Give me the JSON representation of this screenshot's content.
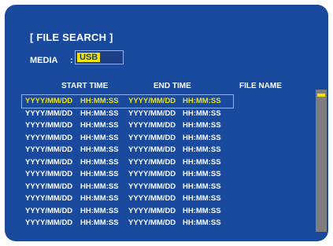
{
  "title": "[ FILE SEARCH ]",
  "media": {
    "label": "MEDIA",
    "colon": ":",
    "value": "USB"
  },
  "columns": {
    "start": "START TIME",
    "end": "END TIME",
    "file": "FILE NAME"
  },
  "rows": [
    {
      "start_date": "YYYY/MM/DD",
      "start_time": "HH:MM:SS",
      "end_date": "YYYY/MM/DD",
      "end_time": "HH:MM:SS",
      "file_name": "",
      "selected": true
    },
    {
      "start_date": "YYYY/MM/DD",
      "start_time": "HH:MM:SS",
      "end_date": "YYYY/MM/DD",
      "end_time": "HH:MM:SS",
      "file_name": ""
    },
    {
      "start_date": "YYYY/MM/DD",
      "start_time": "HH:MM:SS",
      "end_date": "YYYY/MM/DD",
      "end_time": "HH:MM:SS",
      "file_name": ""
    },
    {
      "start_date": "YYYY/MM/DD",
      "start_time": "HH:MM:SS",
      "end_date": "YYYY/MM/DD",
      "end_time": "HH:MM:SS",
      "file_name": ""
    },
    {
      "start_date": "YYYY/MM/DD",
      "start_time": "HH:MM:SS",
      "end_date": "YYYY/MM/DD",
      "end_time": "HH:MM:SS",
      "file_name": ""
    },
    {
      "start_date": "YYYY/MM/DD",
      "start_time": "HH:MM:SS",
      "end_date": "YYYY/MM/DD",
      "end_time": "HH:MM:SS",
      "file_name": ""
    },
    {
      "start_date": "YYYY/MM/DD",
      "start_time": "HH:MM:SS",
      "end_date": "YYYY/MM/DD",
      "end_time": "HH:MM:SS",
      "file_name": ""
    },
    {
      "start_date": "YYYY/MM/DD",
      "start_time": "HH:MM:SS",
      "end_date": "YYYY/MM/DD",
      "end_time": "HH:MM:SS",
      "file_name": ""
    },
    {
      "start_date": "YYYY/MM/DD",
      "start_time": "HH:MM:SS",
      "end_date": "YYYY/MM/DD",
      "end_time": "HH:MM:SS",
      "file_name": ""
    },
    {
      "start_date": "YYYY/MM/DD",
      "start_time": "HH:MM:SS",
      "end_date": "YYYY/MM/DD",
      "end_time": "HH:MM:SS",
      "file_name": ""
    },
    {
      "start_date": "YYYY/MM/DD",
      "start_time": "HH:MM:SS",
      "end_date": "YYYY/MM/DD",
      "end_time": "HH:MM:SS",
      "file_name": ""
    }
  ],
  "scroll": {
    "position": 0.03
  },
  "colors": {
    "background": "#1a4a9e",
    "highlight": "#f2e500",
    "text": "#ffffff",
    "scrollbar": "#7d7d7d"
  }
}
